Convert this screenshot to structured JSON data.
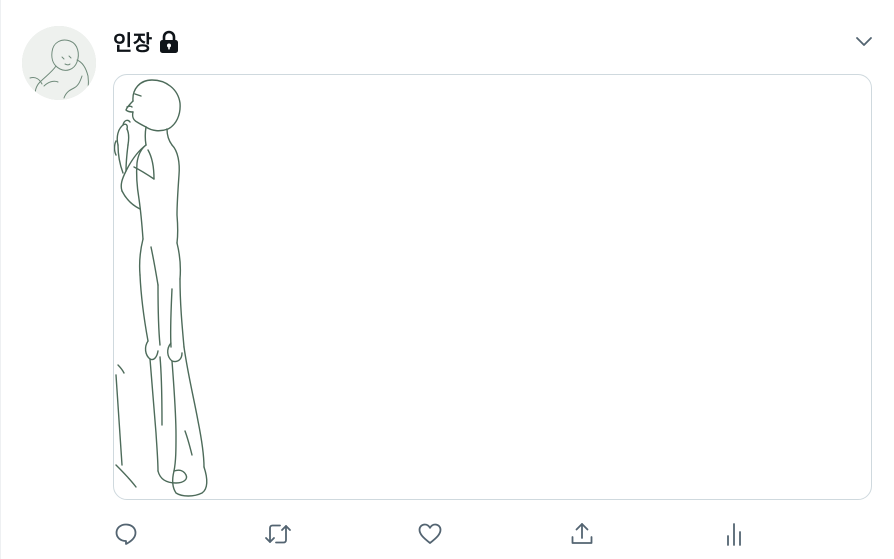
{
  "tweet": {
    "display_name": "인장",
    "protected": true,
    "icons": {
      "lock": "lock-icon",
      "caret": "chevron-down-icon",
      "reply": "reply-icon",
      "retweet": "retweet-icon",
      "like": "heart-icon",
      "share": "share-icon",
      "analytics": "analytics-icon"
    }
  },
  "colors": {
    "text_primary": "#0f1419",
    "icon_gray": "#536471",
    "border": "#cfd9de",
    "sketch_line": "#4d6b5a"
  }
}
